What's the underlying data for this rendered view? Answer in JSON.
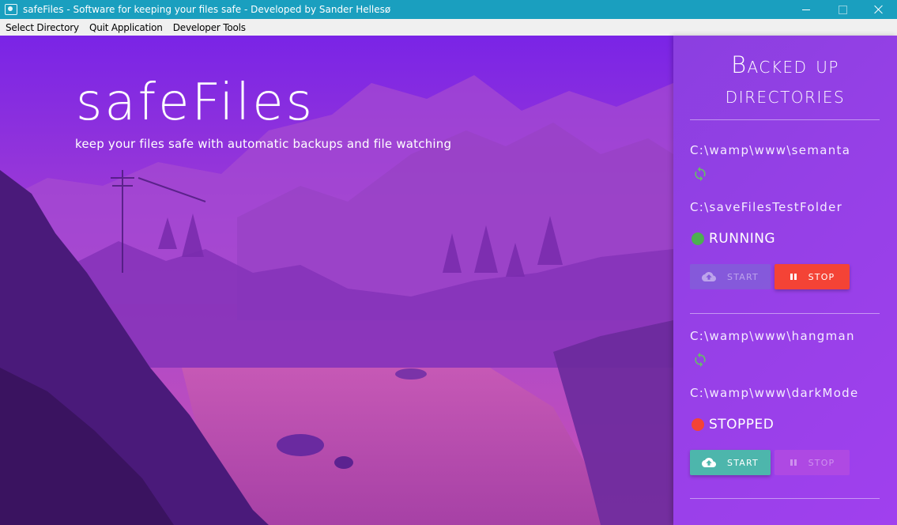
{
  "window": {
    "title": "safeFiles - Software for keeping your files safe - Developed by Sander Hellesø"
  },
  "menu": {
    "items": [
      "Select Directory",
      "Quit Application",
      "Developer Tools"
    ]
  },
  "hero": {
    "brand": "safeFiles",
    "tagline": "keep your files safe with automatic backups and file watching"
  },
  "sidebar": {
    "title_line1": "Backed up",
    "title_line2": "directories",
    "entries": [
      {
        "source": "C:\\wamp\\www\\semanta",
        "destination": "C:\\saveFilesTestFolder",
        "status": "RUNNING",
        "status_color": "#4caf50",
        "start_label": "START",
        "stop_label": "STOP",
        "start_enabled": false,
        "stop_enabled": true
      },
      {
        "source": "C:\\wamp\\www\\hangman",
        "destination": "C:\\wamp\\www\\darkMode",
        "status": "STOPPED",
        "status_color": "#f44336",
        "start_label": "START",
        "stop_label": "STOP",
        "start_enabled": true,
        "stop_enabled": false
      }
    ]
  },
  "colors": {
    "titlebar": "#1a9fbf",
    "sync_icon": "#66bb6a",
    "start_button": "#4db6ac",
    "stop_button": "#f44336"
  },
  "icons": {
    "sync": "sync-icon",
    "cloud_upload": "cloud-upload-icon",
    "pause": "pause-icon"
  }
}
